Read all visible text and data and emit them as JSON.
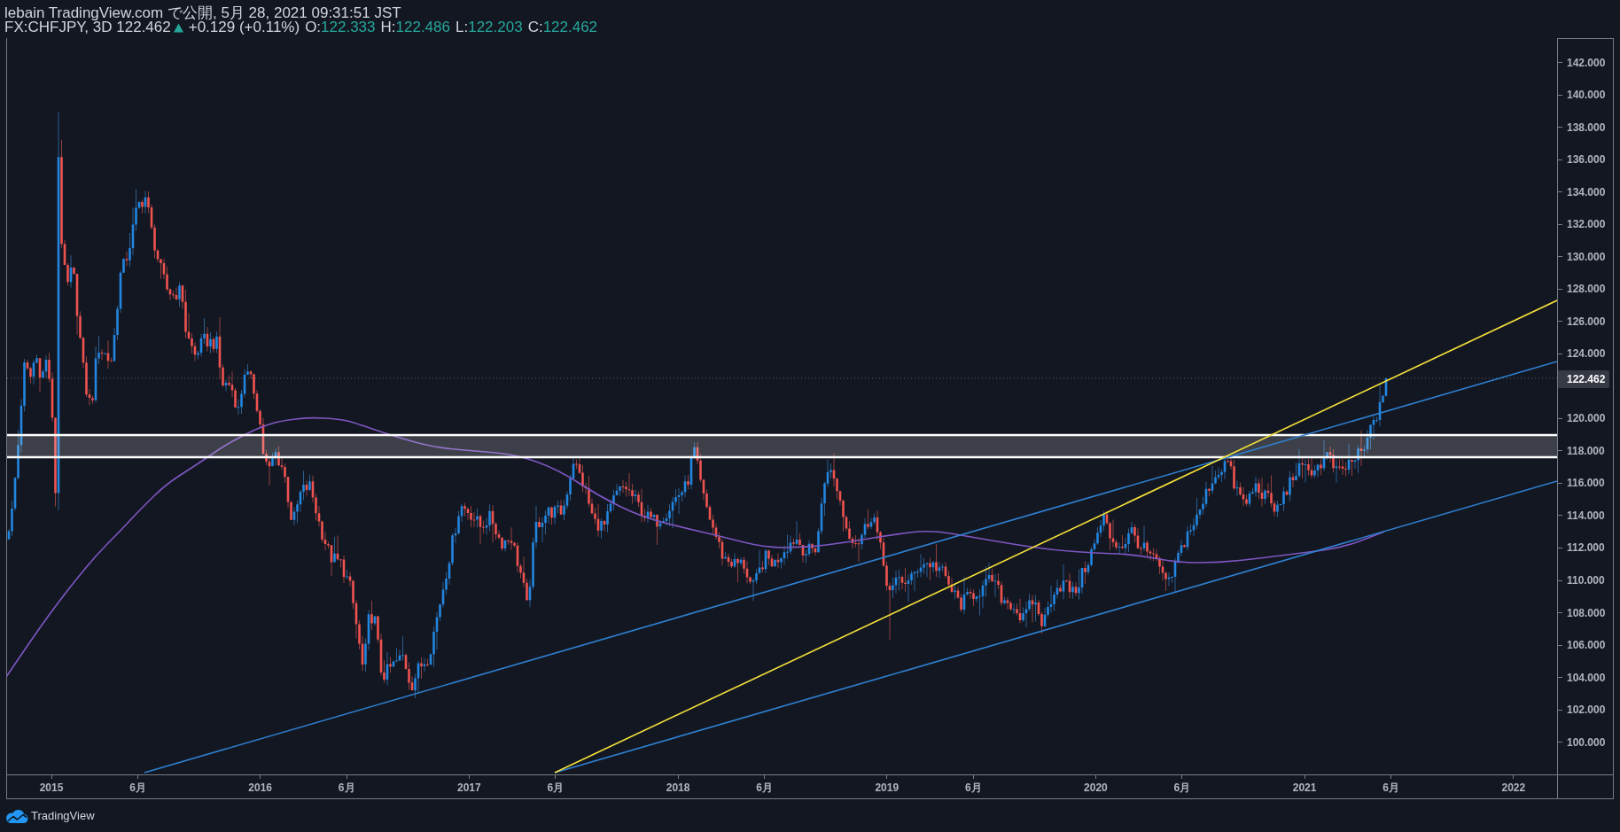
{
  "legend": {
    "publish_line": "lebain TradingView.com で公開, 5月 28, 2021 09:31:51 JST",
    "symbol": "FX:CHFJPY, 3D 122.462",
    "rising": true,
    "change": "+0.129 (+0.11%)",
    "ohlc": [
      {
        "label": "O:",
        "value": "122.333"
      },
      {
        "label": "H:",
        "value": "122.486"
      },
      {
        "label": "L:",
        "value": "122.203"
      },
      {
        "label": "C:",
        "value": "122.462"
      }
    ]
  },
  "price_axis": {
    "labels_above": [
      "142.000",
      "140.000",
      "138.000",
      "136.000",
      "134.000",
      "132.000",
      "130.000",
      "128.000",
      "126.000",
      "124.000"
    ],
    "current_price": "122.462",
    "labels_below": [
      "120.000",
      "118.000",
      "116.000",
      "114.000",
      "112.000",
      "110.000",
      "108.000",
      "106.000",
      "104.000",
      "102.000",
      "100.000"
    ]
  },
  "time_axis": {
    "labels": [
      "2015",
      "6月",
      "2016",
      "6月",
      "2017",
      "6月",
      "2018",
      "6月",
      "2019",
      "6月",
      "2020",
      "6月",
      "2021",
      "6月",
      "2022"
    ]
  },
  "footer": {
    "brand": "TradingView"
  }
}
